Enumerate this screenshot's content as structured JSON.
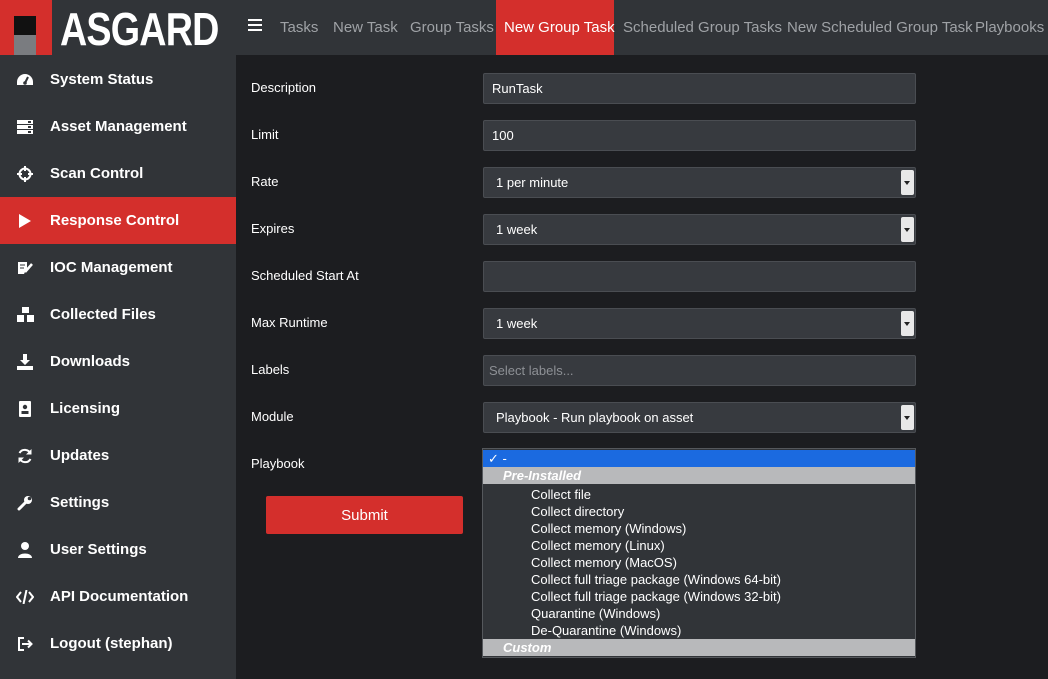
{
  "brand": {
    "name": "ASGARD"
  },
  "topnav": {
    "tabs": [
      {
        "label": "Tasks"
      },
      {
        "label": "New Task"
      },
      {
        "label": "Group Tasks"
      },
      {
        "label": "New Group Task"
      },
      {
        "label": "Scheduled Group Tasks"
      },
      {
        "label": "New Scheduled Group Task"
      },
      {
        "label": "Playbooks"
      }
    ],
    "active_index": 3
  },
  "sidebar": {
    "items": [
      {
        "label": "System Status",
        "icon": "dashboard-icon"
      },
      {
        "label": "Asset Management",
        "icon": "server-icon"
      },
      {
        "label": "Scan Control",
        "icon": "crosshairs-icon"
      },
      {
        "label": "Response Control",
        "icon": "play-icon"
      },
      {
        "label": "IOC Management",
        "icon": "file-edit-icon"
      },
      {
        "label": "Collected Files",
        "icon": "cubes-icon"
      },
      {
        "label": "Downloads",
        "icon": "download-icon"
      },
      {
        "label": "Licensing",
        "icon": "id-badge-icon"
      },
      {
        "label": "Updates",
        "icon": "refresh-icon"
      },
      {
        "label": "Settings",
        "icon": "wrench-icon"
      },
      {
        "label": "User Settings",
        "icon": "user-icon"
      },
      {
        "label": "API Documentation",
        "icon": "code-icon"
      },
      {
        "label": "Logout (stephan)",
        "icon": "logout-icon"
      }
    ],
    "active_index": 3
  },
  "form": {
    "description": {
      "label": "Description",
      "value": "RunTask"
    },
    "limit": {
      "label": "Limit",
      "value": "100"
    },
    "rate": {
      "label": "Rate",
      "value": "1 per minute"
    },
    "expires": {
      "label": "Expires",
      "value": "1 week"
    },
    "scheduled_start": {
      "label": "Scheduled Start At",
      "value": ""
    },
    "max_runtime": {
      "label": "Max Runtime",
      "value": "1 week"
    },
    "labels": {
      "label": "Labels",
      "placeholder": "Select labels..."
    },
    "module": {
      "label": "Module",
      "value": "Playbook - Run playbook on asset"
    },
    "playbook": {
      "label": "Playbook"
    },
    "submit_label": "Submit"
  },
  "playbook_dropdown": {
    "selected": "✓ -",
    "groups": [
      {
        "label": "Pre-Installed",
        "options": [
          "Collect file",
          "Collect directory",
          "Collect memory (Windows)",
          "Collect memory (Linux)",
          "Collect memory (MacOS)",
          "Collect full triage package (Windows 64-bit)",
          "Collect full triage package (Windows 32-bit)",
          "Quarantine (Windows)",
          "De-Quarantine (Windows)"
        ]
      },
      {
        "label": "Custom",
        "options": []
      }
    ]
  },
  "colors": {
    "accent": "#d42f2c",
    "selection": "#1b6ae0",
    "sidebar_bg": "#313438",
    "page_bg": "#1c1d20"
  }
}
